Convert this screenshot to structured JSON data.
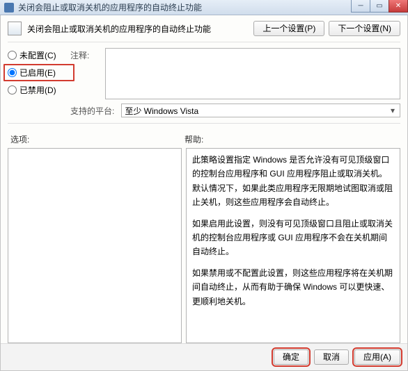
{
  "window": {
    "title": "关闭会阻止或取消关机的应用程序的自动终止功能"
  },
  "header": {
    "title": "关闭会阻止或取消关机的应用程序的自动终止功能",
    "prev": "上一个设置(P)",
    "next": "下一个设置(N)"
  },
  "radios": {
    "not_configured": "未配置(C)",
    "enabled": "已启用(E)",
    "disabled": "已禁用(D)"
  },
  "labels": {
    "comment": "注释:",
    "platform": "支持的平台:",
    "options": "选项:",
    "help": "帮助:"
  },
  "platform_value": "至少 Windows Vista",
  "help_text": {
    "p1": "此策略设置指定 Windows 是否允许没有可见顶级窗口的控制台应用程序和 GUI 应用程序阻止或取消关机。默认情况下，如果此类应用程序无限期地试图取消或阻止关机，则这些应用程序会自动终止。",
    "p2": "如果启用此设置，则没有可见顶级窗口且阻止或取消关机的控制台应用程序或 GUI 应用程序不会在关机期间自动终止。",
    "p3": "如果禁用或不配置此设置，则这些应用程序将在关机期间自动终止，从而有助于确保 Windows 可以更快速、更顺利地关机。"
  },
  "buttons": {
    "ok": "确定",
    "cancel": "取消",
    "apply": "应用(A)"
  }
}
